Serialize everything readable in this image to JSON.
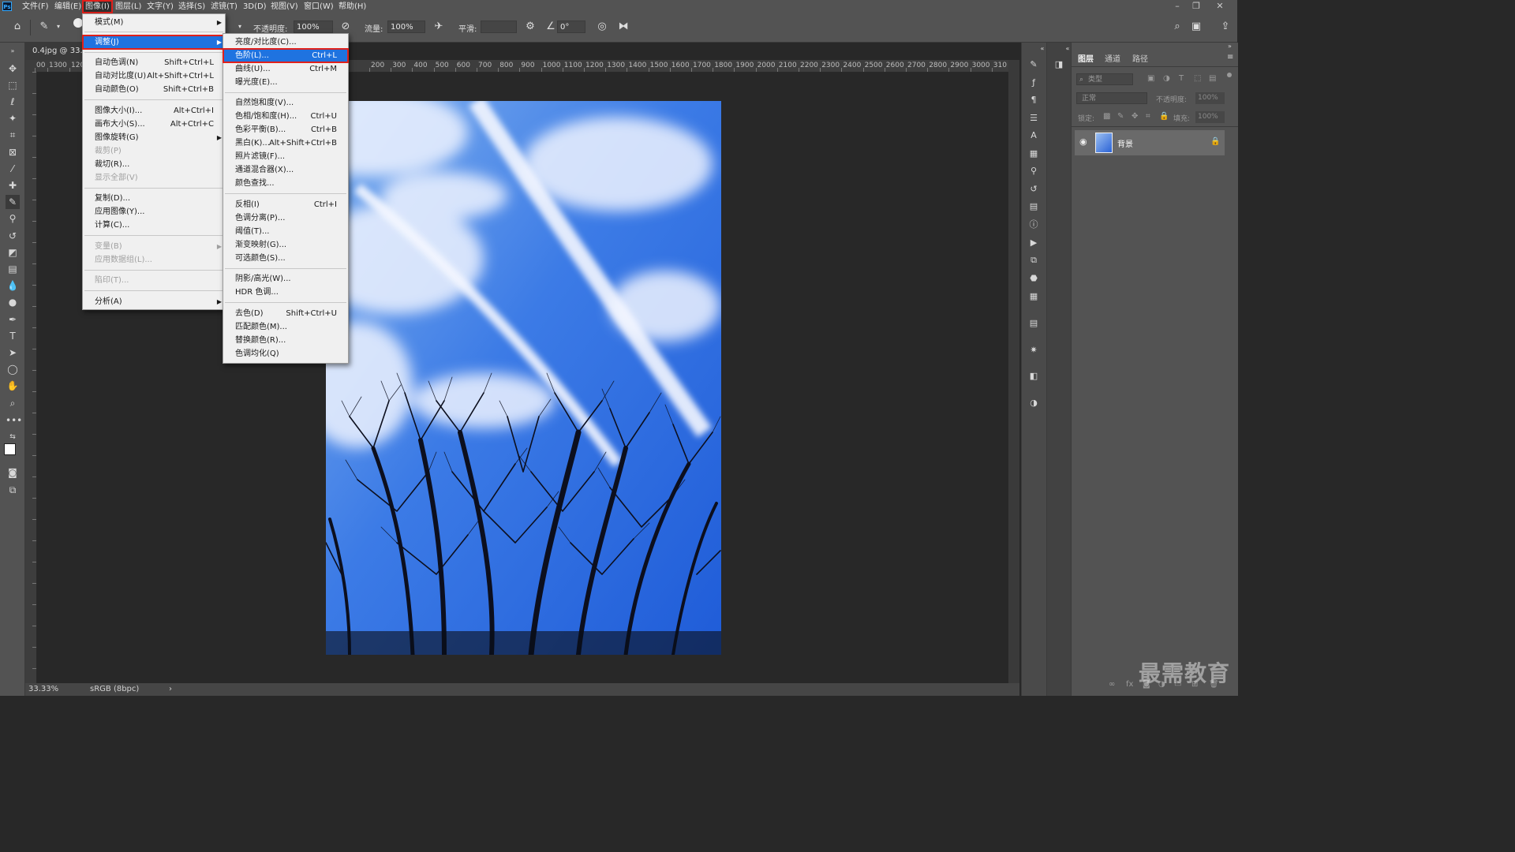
{
  "app": {
    "logo": "Ps"
  },
  "menubar": {
    "items": [
      "文件(F)",
      "编辑(E)",
      "图像(I)",
      "图层(L)",
      "文字(Y)",
      "选择(S)",
      "滤镜(T)",
      "3D(D)",
      "视图(V)",
      "窗口(W)",
      "帮助(H)"
    ],
    "active": "图像(I)"
  },
  "options": {
    "opacity_label": "不透明度:",
    "opacity_value": "100%",
    "flow_label": "流量:",
    "flow_value": "100%",
    "smooth_label": "平滑:",
    "smooth_value": "",
    "angle_value": "0°"
  },
  "document": {
    "tab_title": "0.4jpg @ 33.",
    "zoom": "33.33%",
    "color_profile": "sRGB (8bpc)"
  },
  "ruler_top_labels": [
    "00",
    "1300",
    "120",
    "200",
    "300",
    "400",
    "500",
    "600",
    "700",
    "800",
    "900",
    "1000",
    "1100",
    "1200",
    "1300",
    "1400",
    "1500",
    "1600",
    "1700",
    "1800",
    "1900",
    "2000",
    "2100",
    "2200",
    "2300",
    "2400",
    "2500",
    "2600",
    "2700",
    "2800",
    "2900",
    "3000",
    "310"
  ],
  "image_menu": {
    "items": [
      {
        "label": "模式(M)",
        "shortcut": "",
        "submenu": true
      },
      {
        "label": "调整(J)",
        "shortcut": "",
        "submenu": true,
        "state": "highlighted-boxed"
      },
      {
        "label": "自动色调(N)",
        "shortcut": "Shift+Ctrl+L"
      },
      {
        "label": "自动对比度(U)",
        "shortcut": "Alt+Shift+Ctrl+L"
      },
      {
        "label": "自动颜色(O)",
        "shortcut": "Shift+Ctrl+B"
      },
      {
        "label": "图像大小(I)...",
        "shortcut": "Alt+Ctrl+I"
      },
      {
        "label": "画布大小(S)...",
        "shortcut": "Alt+Ctrl+C"
      },
      {
        "label": "图像旋转(G)",
        "shortcut": "",
        "submenu": true
      },
      {
        "label": "裁剪(P)",
        "shortcut": "",
        "disabled": true
      },
      {
        "label": "裁切(R)...",
        "shortcut": ""
      },
      {
        "label": "显示全部(V)",
        "shortcut": "",
        "disabled": true
      },
      {
        "label": "复制(D)...",
        "shortcut": ""
      },
      {
        "label": "应用图像(Y)...",
        "shortcut": ""
      },
      {
        "label": "计算(C)...",
        "shortcut": ""
      },
      {
        "label": "变量(B)",
        "shortcut": "",
        "submenu": true,
        "disabled": true
      },
      {
        "label": "应用数据组(L)...",
        "shortcut": "",
        "disabled": true
      },
      {
        "label": "陷印(T)...",
        "shortcut": "",
        "disabled": true
      },
      {
        "label": "分析(A)",
        "shortcut": "",
        "submenu": true
      }
    ]
  },
  "adjust_menu": {
    "items": [
      {
        "label": "亮度/对比度(C)...",
        "shortcut": ""
      },
      {
        "label": "色阶(L)...",
        "shortcut": "Ctrl+L",
        "state": "highlighted-boxed"
      },
      {
        "label": "曲线(U)...",
        "shortcut": "Ctrl+M"
      },
      {
        "label": "曝光度(E)...",
        "shortcut": ""
      },
      {
        "label": "自然饱和度(V)...",
        "shortcut": ""
      },
      {
        "label": "色相/饱和度(H)...",
        "shortcut": "Ctrl+U"
      },
      {
        "label": "色彩平衡(B)...",
        "shortcut": "Ctrl+B"
      },
      {
        "label": "黑白(K)...",
        "shortcut": "Alt+Shift+Ctrl+B"
      },
      {
        "label": "照片滤镜(F)...",
        "shortcut": ""
      },
      {
        "label": "通道混合器(X)...",
        "shortcut": ""
      },
      {
        "label": "颜色查找...",
        "shortcut": ""
      },
      {
        "label": "反相(I)",
        "shortcut": "Ctrl+I"
      },
      {
        "label": "色调分离(P)...",
        "shortcut": ""
      },
      {
        "label": "阈值(T)...",
        "shortcut": ""
      },
      {
        "label": "渐变映射(G)...",
        "shortcut": ""
      },
      {
        "label": "可选颜色(S)...",
        "shortcut": ""
      },
      {
        "label": "阴影/高光(W)...",
        "shortcut": ""
      },
      {
        "label": "HDR 色调...",
        "shortcut": ""
      },
      {
        "label": "去色(D)",
        "shortcut": "Shift+Ctrl+U"
      },
      {
        "label": "匹配颜色(M)...",
        "shortcut": ""
      },
      {
        "label": "替换颜色(R)...",
        "shortcut": ""
      },
      {
        "label": "色调均化(Q)",
        "shortcut": ""
      }
    ]
  },
  "layers_panel": {
    "tabs": [
      "图层",
      "通道",
      "路径"
    ],
    "active_tab": "图层",
    "filter_placeholder": "类型",
    "blend_mode": "正常",
    "opacity_label": "不透明度:",
    "opacity_value": "100%",
    "lock_label": "锁定:",
    "fill_label": "填充:",
    "fill_value": "100%",
    "layers": [
      {
        "name": "背景",
        "visible": true,
        "locked": true
      }
    ]
  },
  "watermark": "最需教育",
  "colors": {
    "menu_highlight": "#1f73e0",
    "callout_red": "#e0201b",
    "ui_bg": "#535353",
    "canvas_bg": "#282828"
  }
}
